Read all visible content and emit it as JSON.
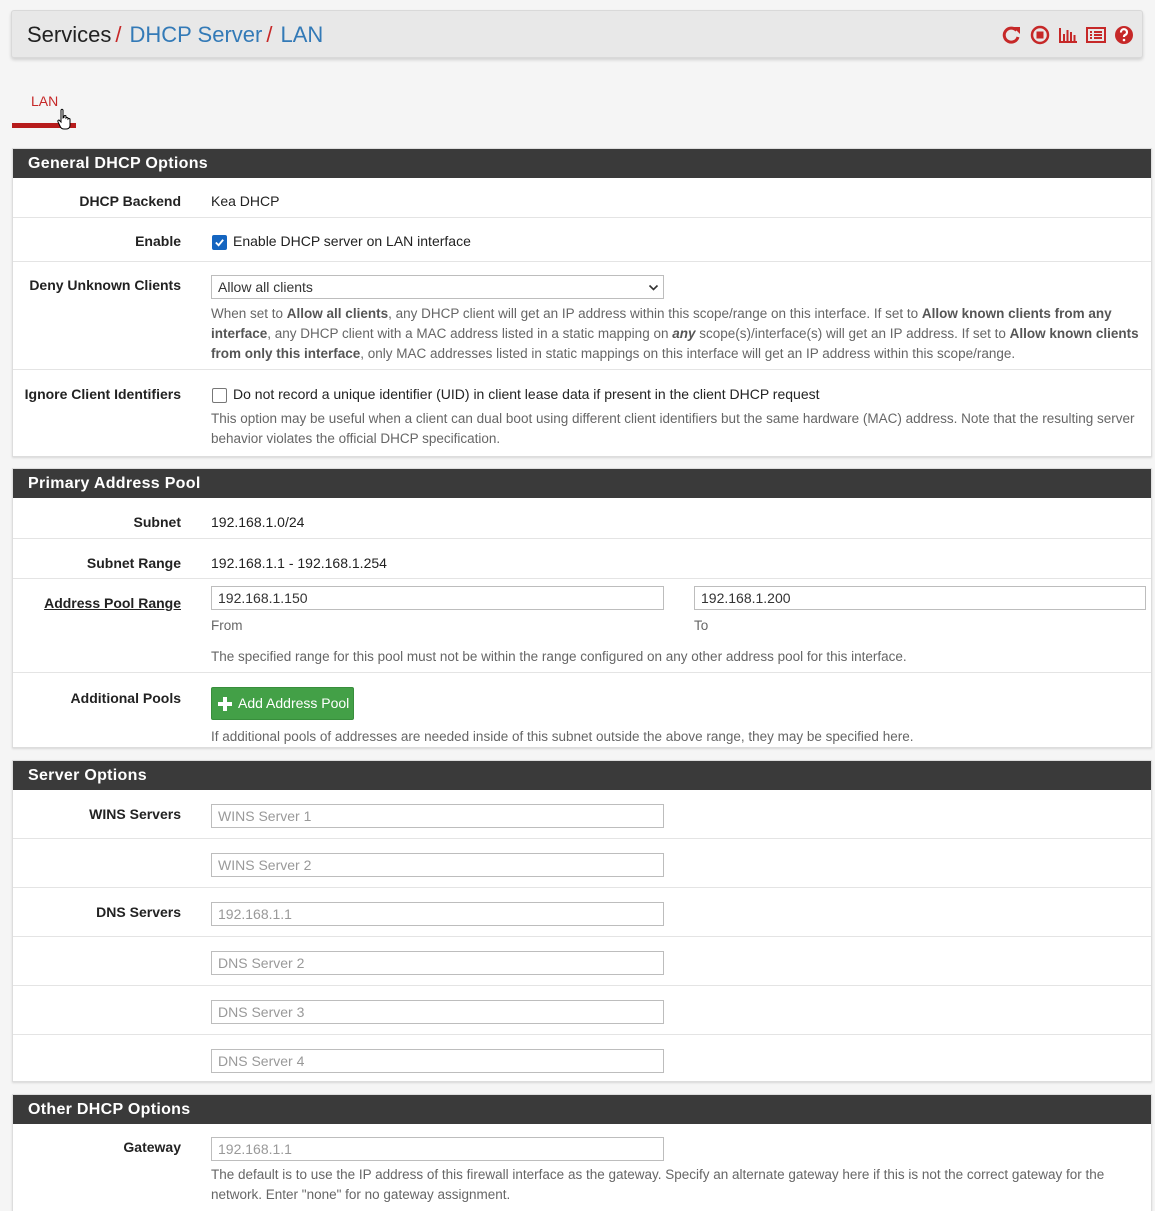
{
  "breadcrumb": {
    "services": "Services",
    "dhcp_server": "DHCP Server",
    "lan": "LAN",
    "sep": "/"
  },
  "header_icons": [
    "restart-icon",
    "stop-icon",
    "chart-icon",
    "list-icon",
    "help-icon"
  ],
  "tabs": [
    {
      "label": "LAN",
      "active": true
    }
  ],
  "general": {
    "title": "General DHCP Options",
    "backend_label": "DHCP Backend",
    "backend_value": "Kea DHCP",
    "enable_label": "Enable",
    "enable_text": "Enable DHCP server on LAN interface",
    "enable_checked": true,
    "deny_label": "Deny Unknown Clients",
    "deny_value": "Allow all clients",
    "deny_help": {
      "p1": "When set to ",
      "b1": "Allow all clients",
      "p2": ", any DHCP client will get an IP address within this scope/range on this interface. If set to ",
      "b2": "Allow known clients from any interface",
      "p3": ", any DHCP client with a MAC address listed in a static mapping on ",
      "b3": "any",
      "p4": " scope(s)/interface(s) will get an IP address. If set to ",
      "b4": "Allow known clients from only this interface",
      "p5": ", only MAC addresses listed in static mappings on this interface will get an IP address within this scope/range."
    },
    "ignore_label": "Ignore Client Identifiers",
    "ignore_text": "Do not record a unique identifier (UID) in client lease data if present in the client DHCP request",
    "ignore_checked": false,
    "ignore_help": "This option may be useful when a client can dual boot using different client identifiers but the same hardware (MAC) address. Note that the resulting server behavior violates the official DHCP specification."
  },
  "pool": {
    "title": "Primary Address Pool",
    "subnet_label": "Subnet",
    "subnet_value": "192.168.1.0/24",
    "range_label": "Subnet Range",
    "range_value": "192.168.1.1 - 192.168.1.254",
    "apr_label": "Address Pool Range",
    "from_value": "192.168.1.150",
    "to_value": "192.168.1.200",
    "from_label": "From",
    "to_label": "To",
    "apr_help": "The specified range for this pool must not be within the range configured on any other address pool for this interface.",
    "additional_label": "Additional Pools",
    "add_button": "Add Address Pool",
    "additional_help": "If additional pools of addresses are needed inside of this subnet outside the above range, they may be specified here."
  },
  "server": {
    "title": "Server Options",
    "wins_label": "WINS Servers",
    "wins1_placeholder": "WINS Server 1",
    "wins2_placeholder": "WINS Server 2",
    "dns_label": "DNS Servers",
    "dns1_placeholder": "192.168.1.1",
    "dns2_placeholder": "DNS Server 2",
    "dns3_placeholder": "DNS Server 3",
    "dns4_placeholder": "DNS Server 4"
  },
  "other": {
    "title": "Other DHCP Options",
    "gateway_label": "Gateway",
    "gateway_placeholder": "192.168.1.1",
    "gateway_help": "The default is to use the IP address of this firewall interface as the gateway. Specify an alternate gateway here if this is not the correct gateway for the network. Enter \"none\" for no gateway assignment."
  },
  "colors": {
    "accent_red": "#c62828",
    "link_blue": "#337ab7",
    "panel_head": "#3a3a3a",
    "button_green": "#43a047"
  }
}
